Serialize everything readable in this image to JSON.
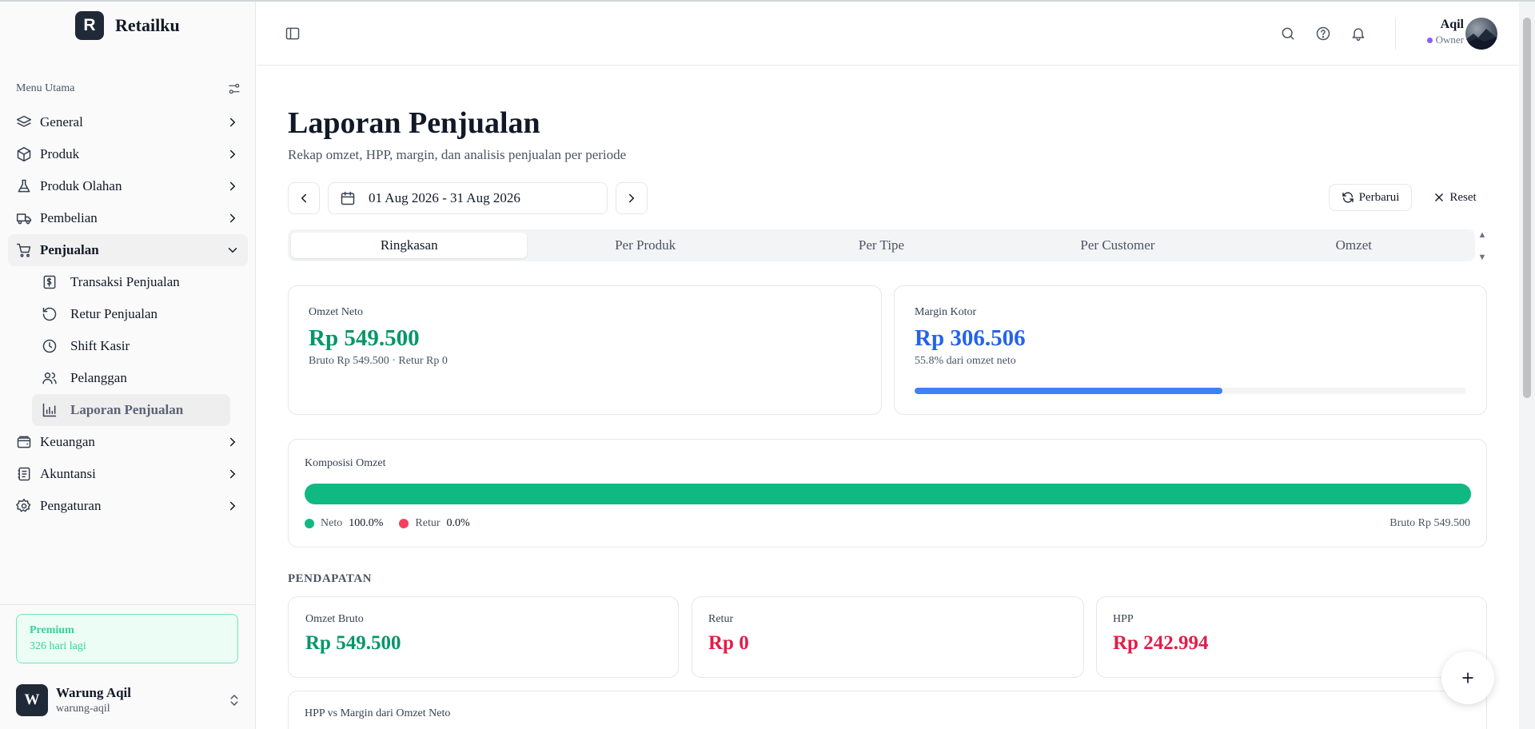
{
  "brand": {
    "logo_letter": "R",
    "name": "Retailku"
  },
  "sidebar": {
    "menu_title": "Menu Utama",
    "items": [
      {
        "label": "General",
        "icon": "layers-icon"
      },
      {
        "label": "Produk",
        "icon": "box-icon"
      },
      {
        "label": "Produk Olahan",
        "icon": "flask-icon"
      },
      {
        "label": "Pembelian",
        "icon": "truck-icon"
      },
      {
        "label": "Penjualan",
        "icon": "cart-icon"
      },
      {
        "label": "Keuangan",
        "icon": "wallet-icon"
      },
      {
        "label": "Akuntansi",
        "icon": "ledger-icon"
      },
      {
        "label": "Pengaturan",
        "icon": "gear-icon"
      }
    ],
    "sub_items": [
      {
        "label": "Transaksi Penjualan",
        "icon": "receipt-icon"
      },
      {
        "label": "Retur Penjualan",
        "icon": "undo-icon"
      },
      {
        "label": "Shift Kasir",
        "icon": "clock-icon"
      },
      {
        "label": "Pelanggan",
        "icon": "users-icon"
      },
      {
        "label": "Laporan Penjualan",
        "icon": "bar-chart-icon"
      }
    ],
    "premium": {
      "title": "Premium",
      "days_left": "326 hari lagi"
    },
    "store": {
      "logo_letter": "W",
      "name": "Warung Aqil",
      "slug": "warung-aqil"
    }
  },
  "header": {
    "user_name": "Aqil",
    "user_role": "Owner"
  },
  "page": {
    "title": "Laporan Penjualan",
    "subtitle": "Rekap omzet, HPP, margin, dan analisis penjualan per periode",
    "date_range": "01 Aug 2026 - 31 Aug 2026",
    "refresh_label": "Perbarui",
    "reset_label": "Reset",
    "tabs": [
      "Ringkasan",
      "Per Produk",
      "Per Tipe",
      "Per Customer",
      "Omzet"
    ],
    "active_tab": 0
  },
  "summary": {
    "omzet_neto": {
      "label": "Omzet Neto",
      "value": "Rp 549.500",
      "sub": "Bruto Rp 549.500 · Retur Rp 0"
    },
    "margin_kotor": {
      "label": "Margin Kotor",
      "value": "Rp 306.506",
      "sub": "55.8% dari omzet neto",
      "progress": 0.558
    }
  },
  "komposisi": {
    "label": "Komposisi Omzet",
    "neto_label": "Neto",
    "neto_pct": "100.0%",
    "neto_fraction": 1.0,
    "retur_label": "Retur",
    "retur_pct": "0.0%",
    "retur_fraction": 0.0,
    "bruto": "Bruto Rp 549.500"
  },
  "pendapatan": {
    "section_title": "PENDAPATAN",
    "cards": [
      {
        "label": "Omzet Bruto",
        "value": "Rp 549.500"
      },
      {
        "label": "Retur",
        "value": "Rp 0"
      },
      {
        "label": "HPP",
        "value": "Rp 242.994"
      }
    ],
    "hpp_vs_margin_label": "HPP vs Margin dari Omzet Neto"
  },
  "colors": {
    "accent_green": "#059669",
    "accent_blue": "#2563eb",
    "accent_red": "#e11d48",
    "bar_green": "#10b981",
    "bar_pink": "#f43f5e"
  }
}
